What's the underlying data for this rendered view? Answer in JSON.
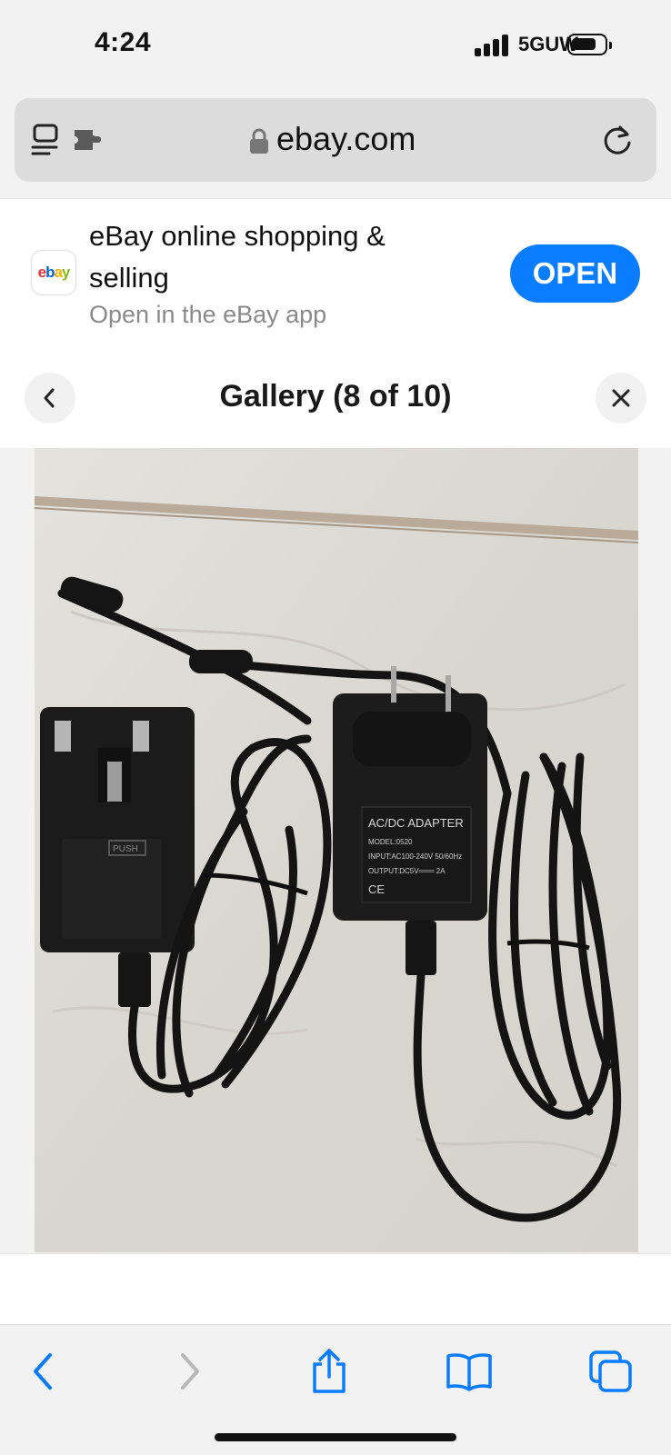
{
  "status_bar": {
    "time": "4:24",
    "network": "5GUW"
  },
  "url_bar": {
    "domain": "ebay.com"
  },
  "app_banner": {
    "logo_letters": [
      "e",
      "b",
      "a",
      "y"
    ],
    "title": "eBay online shopping & selling",
    "subtitle": "Open in the eBay app",
    "open_label": "OPEN"
  },
  "gallery": {
    "title": "Gallery (8 of 10)"
  },
  "photo": {
    "adapter_label": {
      "heading": "AC/DC ADAPTER",
      "model": "MODEL:0520",
      "input": "INPUT:AC100-240V 50/60Hz",
      "output": "OUTPUT:DC5V═══ 2A",
      "marks": "CE"
    },
    "uk_plug_button": "PUSH"
  },
  "colors": {
    "accent": "#0a7cff",
    "toolbar_icons": "#0a7cff"
  }
}
